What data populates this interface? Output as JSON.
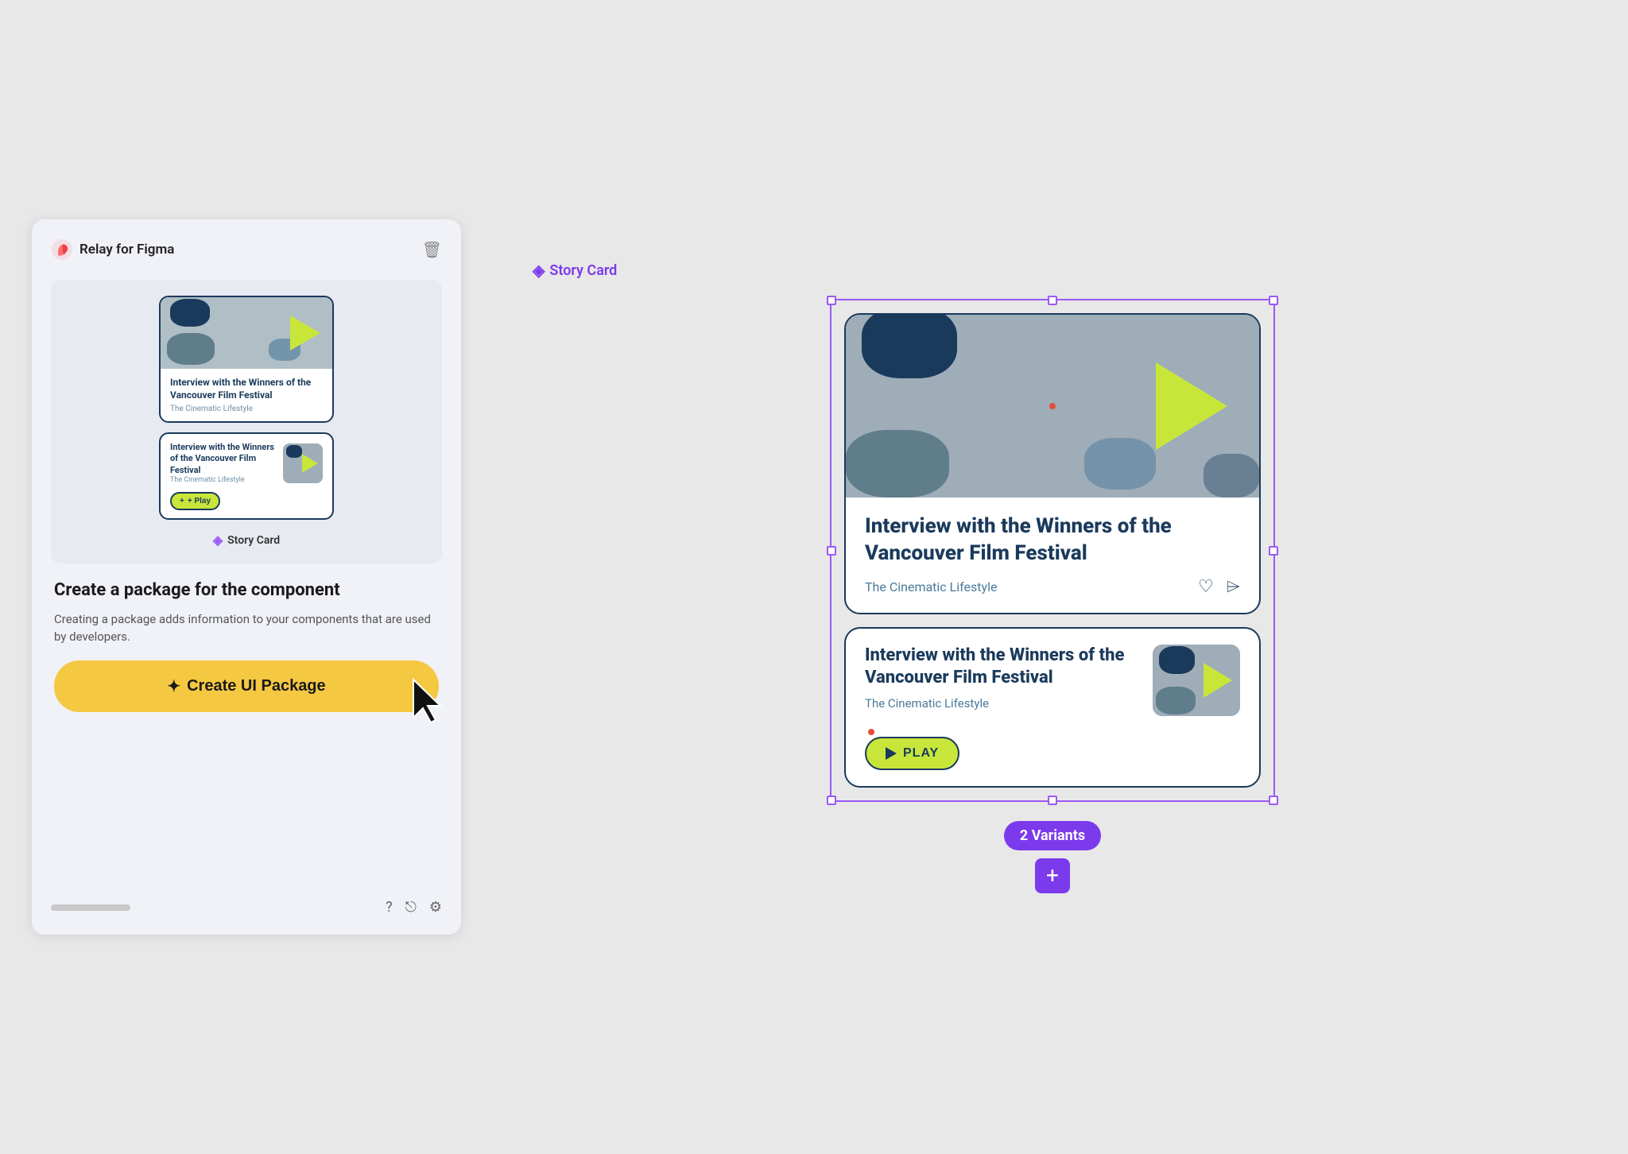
{
  "app": {
    "title": "Relay for Figma"
  },
  "panel": {
    "preview_label": "Story Card",
    "create_title": "Create a package for the component",
    "create_desc": "Creating a package adds information to your components that are used by developers.",
    "create_btn_label": "Create UI Package"
  },
  "card": {
    "title": "Interview with the Winners of the Vancouver Film Festival",
    "subtitle": "The Cinematic Lifestyle",
    "play_label": "PLAY",
    "play_mini_label": "+ Play"
  },
  "right": {
    "story_card_label": "Story Card",
    "variants_label": "2 Variants"
  },
  "icons": {
    "trash": "🗑",
    "help": "?",
    "share": "⎋",
    "settings": "⚙",
    "heart": "♡",
    "share2": "⌲",
    "sparkles": "✦",
    "diamond": "◈",
    "plus": "+"
  }
}
